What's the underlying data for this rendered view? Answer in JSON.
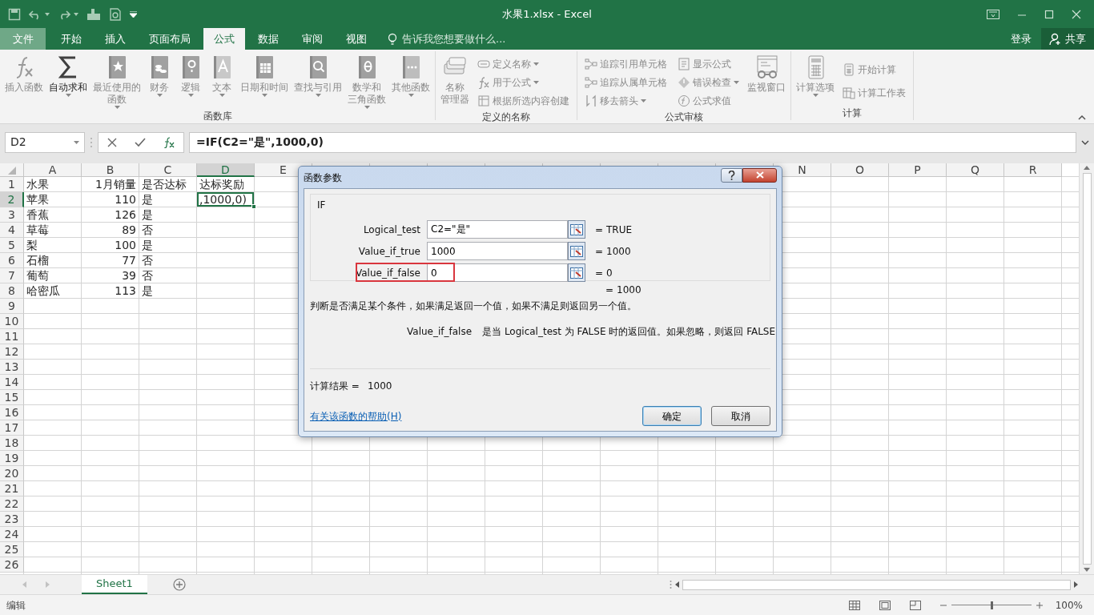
{
  "window": {
    "title": "水果1.xlsx - Excel"
  },
  "tabs": [
    {
      "label": "文件",
      "kind": "backstage",
      "selected": false
    },
    {
      "label": "开始",
      "kind": "tab",
      "selected": false
    },
    {
      "label": "插入",
      "kind": "tab",
      "selected": false
    },
    {
      "label": "页面布局",
      "kind": "tab",
      "selected": false
    },
    {
      "label": "公式",
      "kind": "tab",
      "selected": true
    },
    {
      "label": "数据",
      "kind": "tab",
      "selected": false
    },
    {
      "label": "审阅",
      "kind": "tab",
      "selected": false
    },
    {
      "label": "视图",
      "kind": "tab",
      "selected": false
    }
  ],
  "tell_me": {
    "placeholder": "告诉我您想要做什么..."
  },
  "account": {
    "sign_in": "登录",
    "share": "共享"
  },
  "ribbon": {
    "groups": [
      {
        "label": "函数库",
        "buttons": [
          {
            "kind": "large",
            "lines": [
              "插入函数"
            ],
            "disabled": true,
            "dropdown": false
          },
          {
            "kind": "large",
            "lines": [
              "自动求和"
            ],
            "disabled": false,
            "dropdown": true
          },
          {
            "kind": "large",
            "lines": [
              "最近使用的",
              "函数"
            ],
            "disabled": true,
            "dropdown": true
          },
          {
            "kind": "large",
            "lines": [
              "财务"
            ],
            "disabled": true,
            "dropdown": true
          },
          {
            "kind": "large",
            "lines": [
              "逻辑"
            ],
            "disabled": true,
            "dropdown": true
          },
          {
            "kind": "large",
            "lines": [
              "文本"
            ],
            "disabled": true,
            "dropdown": true
          },
          {
            "kind": "large",
            "lines": [
              "日期和时间"
            ],
            "disabled": true,
            "dropdown": true
          },
          {
            "kind": "large",
            "lines": [
              "查找与引用"
            ],
            "disabled": true,
            "dropdown": true
          },
          {
            "kind": "large",
            "lines": [
              "数学和",
              "三角函数"
            ],
            "disabled": true,
            "dropdown": true
          },
          {
            "kind": "large",
            "lines": [
              "其他函数"
            ],
            "disabled": true,
            "dropdown": true
          }
        ]
      },
      {
        "label": "定义的名称",
        "buttons": [
          {
            "kind": "large",
            "lines": [
              "名称",
              "管理器"
            ],
            "disabled": true,
            "dropdown": false
          },
          {
            "kind": "small",
            "lines": [
              "定义名称"
            ],
            "disabled": true,
            "dropdown": true
          },
          {
            "kind": "small",
            "lines": [
              "用于公式"
            ],
            "disabled": true,
            "dropdown": true
          },
          {
            "kind": "small",
            "lines": [
              "根据所选内容创建"
            ],
            "disabled": true,
            "dropdown": false
          }
        ]
      },
      {
        "label": "公式审核",
        "buttons": [
          {
            "kind": "small",
            "lines": [
              "追踪引用单元格"
            ],
            "disabled": true,
            "dropdown": false
          },
          {
            "kind": "small",
            "lines": [
              "追踪从属单元格"
            ],
            "disabled": true,
            "dropdown": false
          },
          {
            "kind": "small",
            "lines": [
              "移去箭头"
            ],
            "disabled": true,
            "dropdown": true
          },
          {
            "kind": "small",
            "lines": [
              "显示公式"
            ],
            "disabled": true,
            "dropdown": false
          },
          {
            "kind": "small",
            "lines": [
              "错误检查"
            ],
            "disabled": true,
            "dropdown": true
          },
          {
            "kind": "small",
            "lines": [
              "公式求值"
            ],
            "disabled": true,
            "dropdown": false
          },
          {
            "kind": "large",
            "lines": [
              "监视窗口"
            ],
            "disabled": true,
            "dropdown": false
          }
        ]
      },
      {
        "label": "计算",
        "buttons": [
          {
            "kind": "large",
            "lines": [
              "计算选项"
            ],
            "disabled": true,
            "dropdown": true
          },
          {
            "kind": "small",
            "lines": [
              "开始计算"
            ],
            "disabled": true,
            "dropdown": false
          },
          {
            "kind": "small",
            "lines": [
              "计算工作表"
            ],
            "disabled": true,
            "dropdown": false
          }
        ]
      }
    ]
  },
  "formula_bar": {
    "name_box": "D2",
    "formula": "=IF(C2=\"是\",1000,0)"
  },
  "sheet": {
    "columns": [
      {
        "label": "A",
        "selected": false
      },
      {
        "label": "B",
        "selected": false
      },
      {
        "label": "C",
        "selected": false
      },
      {
        "label": "D",
        "selected": true
      },
      {
        "label": "E",
        "selected": false
      },
      {
        "label": "N",
        "selected": false
      },
      {
        "label": "O",
        "selected": false
      },
      {
        "label": "P",
        "selected": false
      },
      {
        "label": "Q",
        "selected": false
      },
      {
        "label": "R",
        "selected": false
      }
    ],
    "row_headers": [
      {
        "label": "1",
        "selected": false
      },
      {
        "label": "2",
        "selected": true
      },
      {
        "label": "3",
        "selected": false
      },
      {
        "label": "4",
        "selected": false
      },
      {
        "label": "5",
        "selected": false
      },
      {
        "label": "6",
        "selected": false
      },
      {
        "label": "7",
        "selected": false
      },
      {
        "label": "8",
        "selected": false
      },
      {
        "label": "9",
        "selected": false
      },
      {
        "label": "10",
        "selected": false
      },
      {
        "label": "11",
        "selected": false
      },
      {
        "label": "12",
        "selected": false
      },
      {
        "label": "13",
        "selected": false
      },
      {
        "label": "14",
        "selected": false
      },
      {
        "label": "15",
        "selected": false
      },
      {
        "label": "16",
        "selected": false
      },
      {
        "label": "17",
        "selected": false
      },
      {
        "label": "18",
        "selected": false
      },
      {
        "label": "19",
        "selected": false
      },
      {
        "label": "20",
        "selected": false
      },
      {
        "label": "21",
        "selected": false
      },
      {
        "label": "22",
        "selected": false
      },
      {
        "label": "23",
        "selected": false
      },
      {
        "label": "24",
        "selected": false
      },
      {
        "label": "25",
        "selected": false
      },
      {
        "label": "26",
        "selected": false
      }
    ],
    "rows": [
      [
        {
          "text": "水果",
          "selected": false
        },
        {
          "text": "1月销量",
          "selected": false
        },
        {
          "text": "是否达标",
          "selected": false
        },
        {
          "text": "达标奖励",
          "selected": false
        }
      ],
      [
        {
          "text": "苹果",
          "selected": false
        },
        {
          "text": "110",
          "selected": false
        },
        {
          "text": "是",
          "selected": false
        },
        {
          "text": ",1000,0)",
          "selected": true
        }
      ],
      [
        {
          "text": "香蕉",
          "selected": false
        },
        {
          "text": "126",
          "selected": false
        },
        {
          "text": "是",
          "selected": false
        }
      ],
      [
        {
          "text": "草莓",
          "selected": false
        },
        {
          "text": "89",
          "selected": false
        },
        {
          "text": "否",
          "selected": false
        }
      ],
      [
        {
          "text": "梨",
          "selected": false
        },
        {
          "text": "100",
          "selected": false
        },
        {
          "text": "是",
          "selected": false
        }
      ],
      [
        {
          "text": "石榴",
          "selected": false
        },
        {
          "text": "77",
          "selected": false
        },
        {
          "text": "否",
          "selected": false
        }
      ],
      [
        {
          "text": "葡萄",
          "selected": false
        },
        {
          "text": "39",
          "selected": false
        },
        {
          "text": "否",
          "selected": false
        }
      ],
      [
        {
          "text": "哈密瓜",
          "selected": false
        },
        {
          "text": "113",
          "selected": false
        },
        {
          "text": "是",
          "selected": false
        }
      ]
    ]
  },
  "dialog": {
    "title": "函数参数",
    "function_name": "IF",
    "args": [
      {
        "label": "Logical_test",
        "value": "C2=\"是\"",
        "eq": "=",
        "result": "TRUE",
        "highlighted": false
      },
      {
        "label": "Value_if_true",
        "value": "1000",
        "eq": "=",
        "result": "1000",
        "highlighted": false
      },
      {
        "label": "Value_if_false",
        "value": "0",
        "eq": "=",
        "result": "0",
        "highlighted": true
      }
    ],
    "formula_result": {
      "eq": "=",
      "value": "1000"
    },
    "description": "判断是否满足某个条件，如果满足返回一个值，如果不满足则返回另一个值。",
    "arg_help": {
      "name": "Value_if_false",
      "text": "是当 Logical_test 为 FALSE 时的返回值。如果忽略，则返回 FALSE"
    },
    "result_label": "计算结果 =",
    "result_value": "1000",
    "help_link": "有关该函数的帮助(H)",
    "buttons": [
      {
        "label": "确定",
        "default": true
      },
      {
        "label": "取消",
        "default": false
      }
    ]
  },
  "sheet_tabs": [
    {
      "label": "Sheet1",
      "selected": true
    }
  ],
  "status_bar": {
    "mode": "编辑",
    "zoom": {
      "level": 0.5,
      "reading": "100%"
    }
  }
}
